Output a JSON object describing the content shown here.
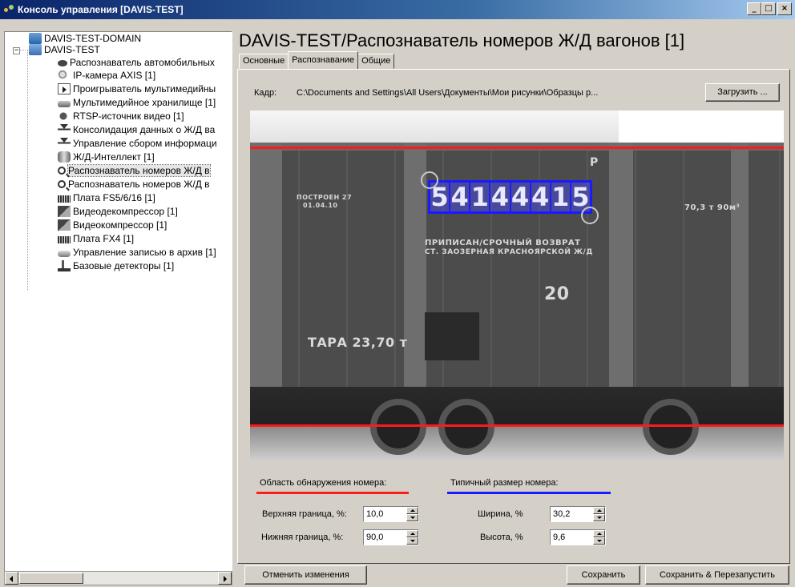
{
  "window": {
    "title": "Консоль управления [DAVIS-TEST]",
    "buttons": [
      "_",
      "□",
      "×"
    ]
  },
  "tree": {
    "items": [
      {
        "label": "DAVIS-TEST-DOMAIN",
        "icon": "domain-icon"
      },
      {
        "label": "DAVIS-TEST",
        "icon": "server-icon"
      },
      {
        "label": "Распознаватель автомобильных",
        "icon": "camera-icon"
      },
      {
        "label": "IP-камера AXIS [1]",
        "icon": "ip-camera-icon"
      },
      {
        "label": "Проигрыватель мультимедийны",
        "icon": "player-icon"
      },
      {
        "label": "Мультимедийное хранилище [1]",
        "icon": "storage-icon"
      },
      {
        "label": "RTSP-источник видео [1]",
        "icon": "rtsp-icon"
      },
      {
        "label": "Консолидация данных о Ж/Д ва",
        "icon": "antenna-icon"
      },
      {
        "label": "Управление сбором информаци",
        "icon": "antenna-icon"
      },
      {
        "label": "Ж/Д-Интеллект [1]",
        "icon": "database-icon"
      },
      {
        "label": "Распознаватель номеров Ж/Д в",
        "icon": "search-icon"
      },
      {
        "label": "Распознаватель номеров Ж/Д в",
        "icon": "search-icon"
      },
      {
        "label": "Плата FS5/6/16 [1]",
        "icon": "board-icon"
      },
      {
        "label": "Видеодекомпрессор [1]",
        "icon": "decompressor-icon"
      },
      {
        "label": "Видеокомпрессор [1]",
        "icon": "compressor-icon"
      },
      {
        "label": "Плата FX4 [1]",
        "icon": "board-icon"
      },
      {
        "label": "Управление записью в архив [1]",
        "icon": "archive-icon"
      },
      {
        "label": "Базовые детекторы [1]",
        "icon": "detector-icon"
      }
    ],
    "selected_index": 10
  },
  "main": {
    "title": "DAVIS-TEST/Распознаватель номеров Ж/Д вагонов [1]",
    "tabs": [
      {
        "label": "Основные",
        "active": false
      },
      {
        "label": "Распознавание",
        "active": true
      },
      {
        "label": "Общие",
        "active": false
      }
    ],
    "frame_label": "Кадр:",
    "frame_path": "C:\\Documents and Settings\\All Users\\Документы\\Мои рисунки\\Образцы р...",
    "load_button": "Загрузить ...",
    "image": {
      "recognized_digits": [
        "5",
        "4",
        "1",
        "4",
        "4",
        "4",
        "1",
        "5"
      ],
      "stencils": {
        "built": "ПОСТРОЕН 27",
        "built_date": "01.04.10",
        "capacity": "70,3 т   90м³",
        "assigned_line1": "ПРИПИСАН/СРОЧНЫЙ ВОЗВРАТ",
        "assigned_line2": "СТ. ЗАОЗЕРНАЯ КРАСНОЯРСКОЙ Ж/Д",
        "number20": "20",
        "tare": "ТАРА 23,70 т",
        "p_mark": "P"
      },
      "line_colors": {
        "detection": "#ff1a1a",
        "size": "#1a1aff"
      }
    },
    "detection_area": {
      "title": "Область обнаружения номера:",
      "top_label": "Верхняя граница, %:",
      "top_value": "10,0",
      "bottom_label": "Нижняя граница, %:",
      "bottom_value": "90,0"
    },
    "typical_size": {
      "title": "Типичный размер номера:",
      "width_label": "Ширина, %",
      "width_value": "30,2",
      "height_label": "Высота, %",
      "height_value": "9,6"
    },
    "buttons": {
      "cancel": "Отменить изменения",
      "save": "Сохранить",
      "save_restart": "Сохранить & Перезапустить"
    }
  }
}
